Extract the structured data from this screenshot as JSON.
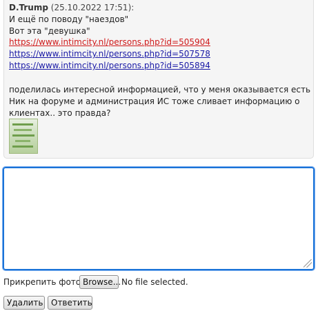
{
  "quote": {
    "author": "D.Trump",
    "date": "(25.10.2022 17:51):",
    "line1": "И ещё по поводу \"наездов\"",
    "line2": "Вот эта \"девушка\"",
    "links": [
      "https://www.intimcity.nl/persons.php?id=505904",
      "https://www.intimcity.nl/persons.php?id=507578",
      "https://www.intimcity.nl/persons.php?id=505894"
    ],
    "paragraph": "поделилась интересной информацией, что у меня оказывается есть Ник на форуме и администрация ИС тоже сливает информацию о клиентах.. это правда?"
  },
  "reply": {
    "textarea_value": ""
  },
  "attach": {
    "label": "Прикрепить фото:",
    "browse_label": "Browse...",
    "status": "No file selected."
  },
  "actions": {
    "delete_label": "Удалить",
    "reply_label": "Ответить"
  },
  "colors": {
    "link": "#1a1aa6",
    "visited_link": "#d01919",
    "focus_border": "#1a73d8"
  }
}
